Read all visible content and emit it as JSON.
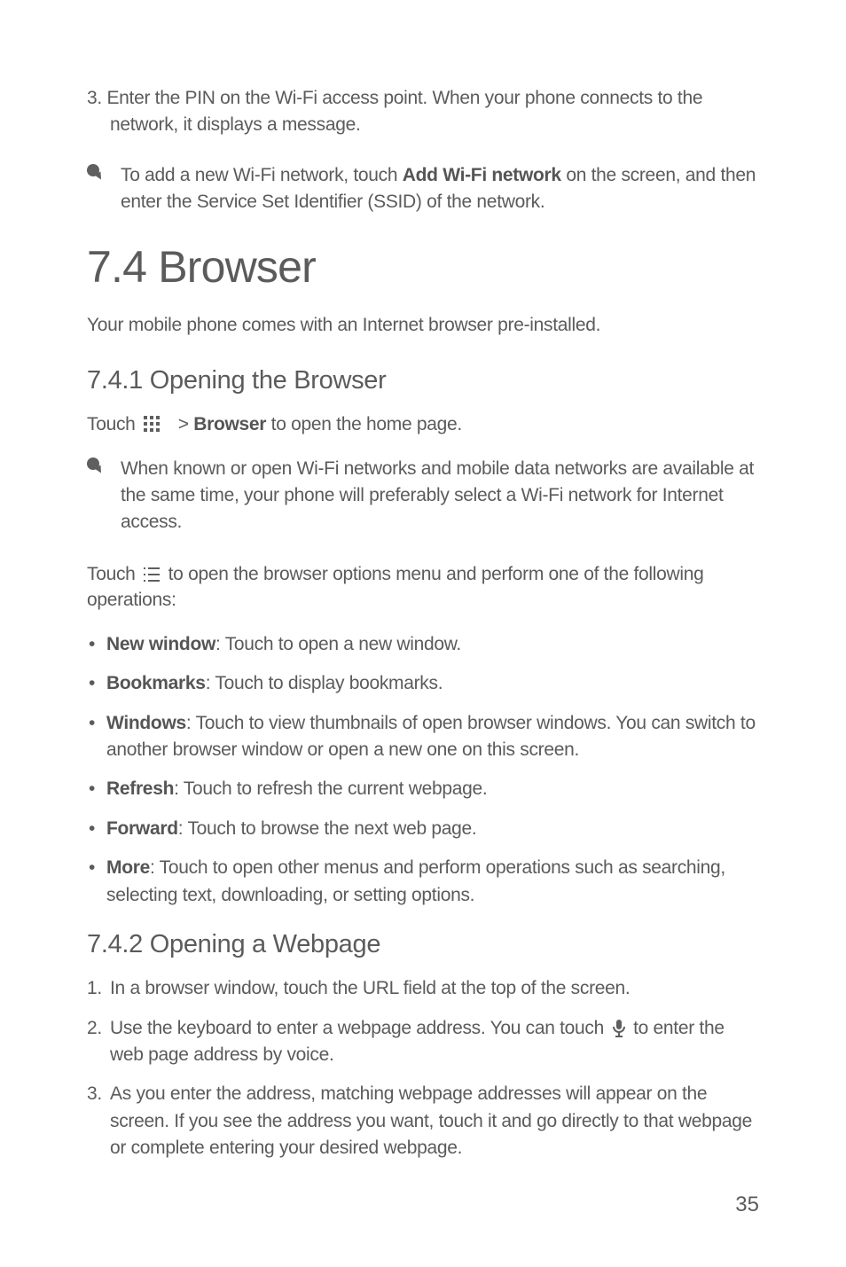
{
  "top_step": {
    "prefix": "3. ",
    "line1_rest": "Enter the PIN on the Wi-Fi access point. When your phone connects to the",
    "line2": "network, it displays a message."
  },
  "tip1": {
    "pre": "To add a new Wi-Fi network, touch ",
    "bold": "Add Wi-Fi network",
    "post": " on the screen, and then enter the Service Set Identifier (SSID) of the network."
  },
  "section_title": "7.4  Browser",
  "intro": "Your mobile phone comes with an Internet browser pre-installed.",
  "sub1_title": "7.4.1  Opening the Browser",
  "touch1": {
    "pre": "Touch ",
    "mid": "  > ",
    "bold": "Browser",
    "post": " to open the home page."
  },
  "tip2": "When known or open Wi-Fi networks and mobile data networks are available at the same time, your phone will preferably select a Wi-Fi network for Internet access.",
  "touch2": {
    "pre": "Touch ",
    "post": " to open the browser options menu and perform one of the following operations:"
  },
  "bullets": [
    {
      "bold": "New window",
      "text": ": Touch to open a new window."
    },
    {
      "bold": "Bookmarks",
      "text": ": Touch to display bookmarks."
    },
    {
      "bold": "Windows",
      "text": ": Touch to view thumbnails of open browser windows. You can switch to another browser window or open a new one on this screen."
    },
    {
      "bold": "Refresh",
      "text": ": Touch to refresh the current webpage."
    },
    {
      "bold": "Forward",
      "text": ": Touch to browse the next web page."
    },
    {
      "bold": "More",
      "text": ": Touch to open other menus and perform operations such as searching, selecting text, downloading, or setting options."
    }
  ],
  "sub2_title": "7.4.2  Opening a Webpage",
  "steps": [
    {
      "text": "In a browser window, touch the URL field at the top of the screen."
    },
    {
      "pre": "Use the keyboard to enter a webpage address. You can touch   ",
      "post": "  to enter the web page address by voice.",
      "has_mic": true
    },
    {
      "text": "As you enter the address, matching webpage addresses will appear on the screen. If you see the address you want, touch it and go directly to that webpage or complete entering your desired webpage."
    }
  ],
  "page_number": "35"
}
